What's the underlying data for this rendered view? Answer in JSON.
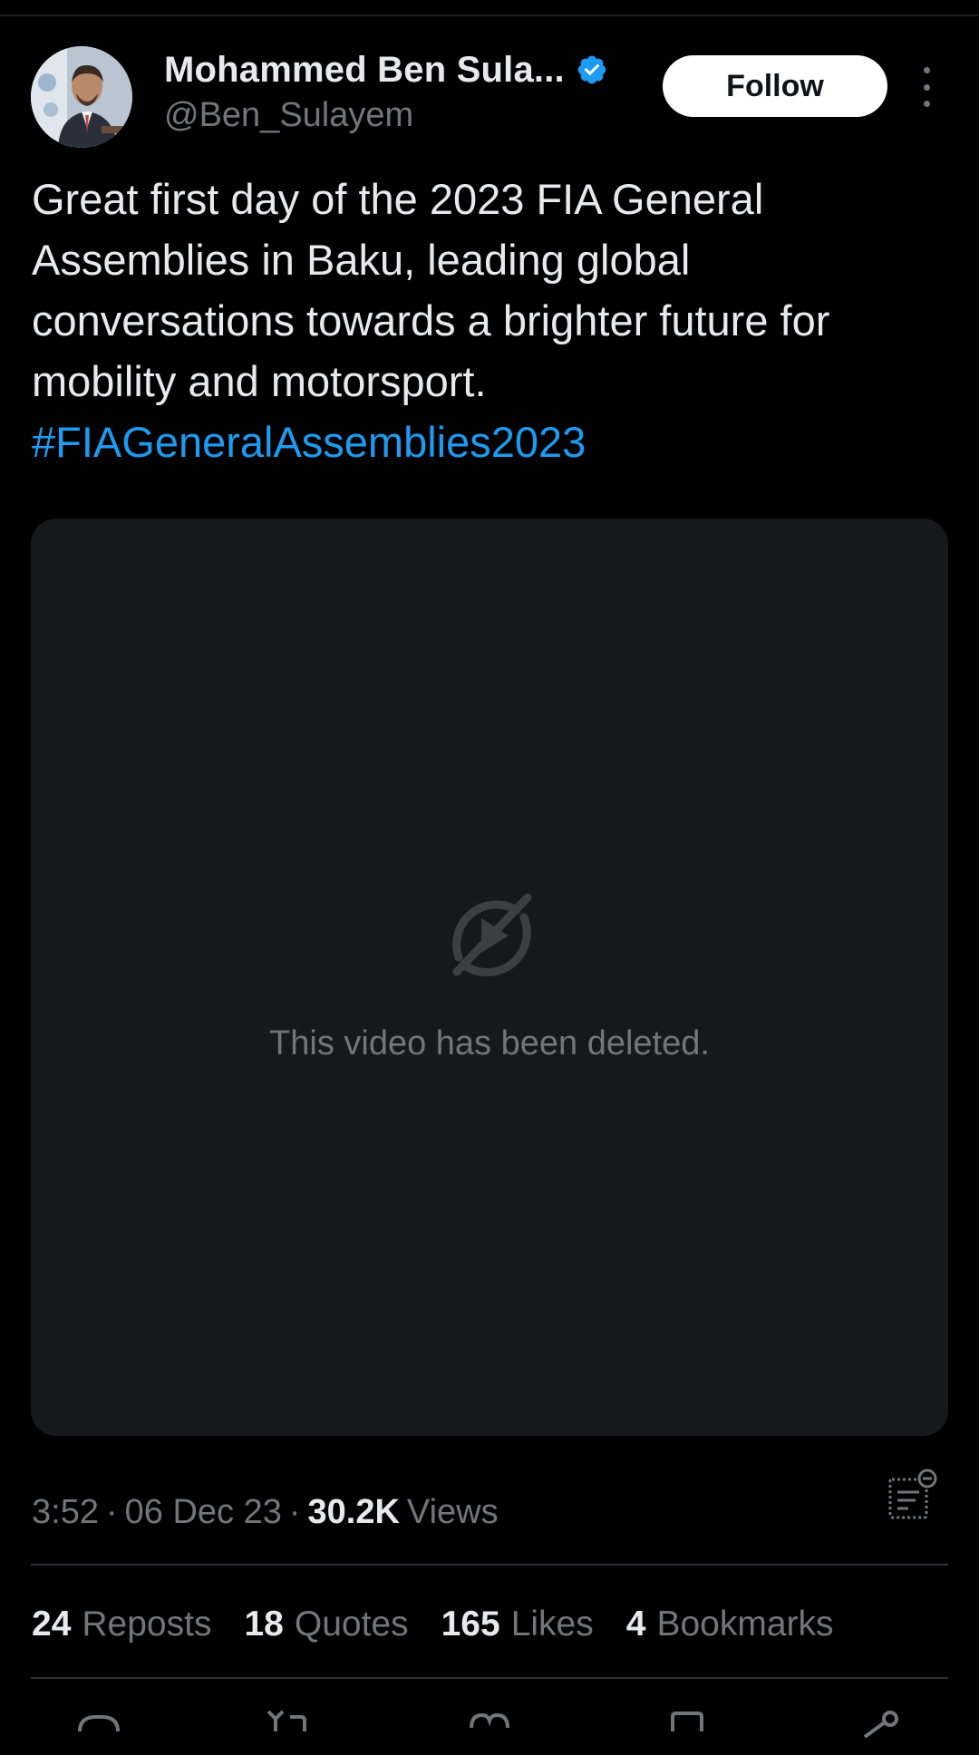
{
  "author": {
    "display_name": "Mohammed Ben Sula...",
    "handle": "@Ben_Sulayem",
    "verified": true,
    "verified_color": "#1d9bf0"
  },
  "follow_button": {
    "label": "Follow"
  },
  "tweet": {
    "text": "Great first day of the 2023 FIA General Assemblies in Baku, leading global conversations towards a brighter future for mobility and motorsport.",
    "hashtag": "#FIAGeneralAssemblies2023",
    "hashtag_color": "#1d9bf0"
  },
  "media": {
    "status_text": "This video has been deleted.",
    "icon": "video-deleted-icon"
  },
  "meta": {
    "time": "3:52",
    "separator": "·",
    "date": "06 Dec 23",
    "views_count": "30.2K",
    "views_label": "Views"
  },
  "stats": [
    {
      "count": "24",
      "label": "Reposts"
    },
    {
      "count": "18",
      "label": "Quotes"
    },
    {
      "count": "165",
      "label": "Likes"
    },
    {
      "count": "4",
      "label": "Bookmarks"
    }
  ],
  "actions": [
    "reply-icon",
    "repost-icon",
    "like-icon",
    "bookmark-icon",
    "share-icon"
  ],
  "colors": {
    "background": "#000000",
    "text_primary": "#e7e9ea",
    "text_secondary": "#71767b",
    "media_background": "#16181c"
  }
}
